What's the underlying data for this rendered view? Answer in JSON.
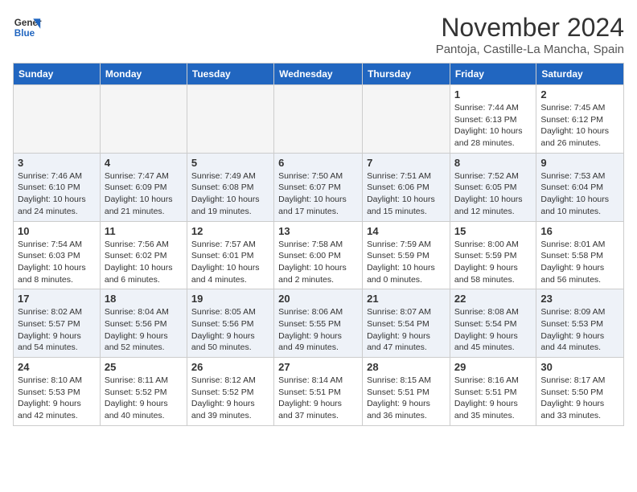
{
  "header": {
    "logo_line1": "General",
    "logo_line2": "Blue",
    "month": "November 2024",
    "location": "Pantoja, Castille-La Mancha, Spain"
  },
  "weekdays": [
    "Sunday",
    "Monday",
    "Tuesday",
    "Wednesday",
    "Thursday",
    "Friday",
    "Saturday"
  ],
  "weeks": [
    [
      {
        "day": "",
        "empty": true
      },
      {
        "day": "",
        "empty": true
      },
      {
        "day": "",
        "empty": true
      },
      {
        "day": "",
        "empty": true
      },
      {
        "day": "",
        "empty": true
      },
      {
        "day": "1",
        "sunrise": "Sunrise: 7:44 AM",
        "sunset": "Sunset: 6:13 PM",
        "daylight": "Daylight: 10 hours and 28 minutes."
      },
      {
        "day": "2",
        "sunrise": "Sunrise: 7:45 AM",
        "sunset": "Sunset: 6:12 PM",
        "daylight": "Daylight: 10 hours and 26 minutes."
      }
    ],
    [
      {
        "day": "3",
        "sunrise": "Sunrise: 7:46 AM",
        "sunset": "Sunset: 6:10 PM",
        "daylight": "Daylight: 10 hours and 24 minutes."
      },
      {
        "day": "4",
        "sunrise": "Sunrise: 7:47 AM",
        "sunset": "Sunset: 6:09 PM",
        "daylight": "Daylight: 10 hours and 21 minutes."
      },
      {
        "day": "5",
        "sunrise": "Sunrise: 7:49 AM",
        "sunset": "Sunset: 6:08 PM",
        "daylight": "Daylight: 10 hours and 19 minutes."
      },
      {
        "day": "6",
        "sunrise": "Sunrise: 7:50 AM",
        "sunset": "Sunset: 6:07 PM",
        "daylight": "Daylight: 10 hours and 17 minutes."
      },
      {
        "day": "7",
        "sunrise": "Sunrise: 7:51 AM",
        "sunset": "Sunset: 6:06 PM",
        "daylight": "Daylight: 10 hours and 15 minutes."
      },
      {
        "day": "8",
        "sunrise": "Sunrise: 7:52 AM",
        "sunset": "Sunset: 6:05 PM",
        "daylight": "Daylight: 10 hours and 12 minutes."
      },
      {
        "day": "9",
        "sunrise": "Sunrise: 7:53 AM",
        "sunset": "Sunset: 6:04 PM",
        "daylight": "Daylight: 10 hours and 10 minutes."
      }
    ],
    [
      {
        "day": "10",
        "sunrise": "Sunrise: 7:54 AM",
        "sunset": "Sunset: 6:03 PM",
        "daylight": "Daylight: 10 hours and 8 minutes."
      },
      {
        "day": "11",
        "sunrise": "Sunrise: 7:56 AM",
        "sunset": "Sunset: 6:02 PM",
        "daylight": "Daylight: 10 hours and 6 minutes."
      },
      {
        "day": "12",
        "sunrise": "Sunrise: 7:57 AM",
        "sunset": "Sunset: 6:01 PM",
        "daylight": "Daylight: 10 hours and 4 minutes."
      },
      {
        "day": "13",
        "sunrise": "Sunrise: 7:58 AM",
        "sunset": "Sunset: 6:00 PM",
        "daylight": "Daylight: 10 hours and 2 minutes."
      },
      {
        "day": "14",
        "sunrise": "Sunrise: 7:59 AM",
        "sunset": "Sunset: 5:59 PM",
        "daylight": "Daylight: 10 hours and 0 minutes."
      },
      {
        "day": "15",
        "sunrise": "Sunrise: 8:00 AM",
        "sunset": "Sunset: 5:59 PM",
        "daylight": "Daylight: 9 hours and 58 minutes."
      },
      {
        "day": "16",
        "sunrise": "Sunrise: 8:01 AM",
        "sunset": "Sunset: 5:58 PM",
        "daylight": "Daylight: 9 hours and 56 minutes."
      }
    ],
    [
      {
        "day": "17",
        "sunrise": "Sunrise: 8:02 AM",
        "sunset": "Sunset: 5:57 PM",
        "daylight": "Daylight: 9 hours and 54 minutes."
      },
      {
        "day": "18",
        "sunrise": "Sunrise: 8:04 AM",
        "sunset": "Sunset: 5:56 PM",
        "daylight": "Daylight: 9 hours and 52 minutes."
      },
      {
        "day": "19",
        "sunrise": "Sunrise: 8:05 AM",
        "sunset": "Sunset: 5:56 PM",
        "daylight": "Daylight: 9 hours and 50 minutes."
      },
      {
        "day": "20",
        "sunrise": "Sunrise: 8:06 AM",
        "sunset": "Sunset: 5:55 PM",
        "daylight": "Daylight: 9 hours and 49 minutes."
      },
      {
        "day": "21",
        "sunrise": "Sunrise: 8:07 AM",
        "sunset": "Sunset: 5:54 PM",
        "daylight": "Daylight: 9 hours and 47 minutes."
      },
      {
        "day": "22",
        "sunrise": "Sunrise: 8:08 AM",
        "sunset": "Sunset: 5:54 PM",
        "daylight": "Daylight: 9 hours and 45 minutes."
      },
      {
        "day": "23",
        "sunrise": "Sunrise: 8:09 AM",
        "sunset": "Sunset: 5:53 PM",
        "daylight": "Daylight: 9 hours and 44 minutes."
      }
    ],
    [
      {
        "day": "24",
        "sunrise": "Sunrise: 8:10 AM",
        "sunset": "Sunset: 5:53 PM",
        "daylight": "Daylight: 9 hours and 42 minutes."
      },
      {
        "day": "25",
        "sunrise": "Sunrise: 8:11 AM",
        "sunset": "Sunset: 5:52 PM",
        "daylight": "Daylight: 9 hours and 40 minutes."
      },
      {
        "day": "26",
        "sunrise": "Sunrise: 8:12 AM",
        "sunset": "Sunset: 5:52 PM",
        "daylight": "Daylight: 9 hours and 39 minutes."
      },
      {
        "day": "27",
        "sunrise": "Sunrise: 8:14 AM",
        "sunset": "Sunset: 5:51 PM",
        "daylight": "Daylight: 9 hours and 37 minutes."
      },
      {
        "day": "28",
        "sunrise": "Sunrise: 8:15 AM",
        "sunset": "Sunset: 5:51 PM",
        "daylight": "Daylight: 9 hours and 36 minutes."
      },
      {
        "day": "29",
        "sunrise": "Sunrise: 8:16 AM",
        "sunset": "Sunset: 5:51 PM",
        "daylight": "Daylight: 9 hours and 35 minutes."
      },
      {
        "day": "30",
        "sunrise": "Sunrise: 8:17 AM",
        "sunset": "Sunset: 5:50 PM",
        "daylight": "Daylight: 9 hours and 33 minutes."
      }
    ]
  ]
}
